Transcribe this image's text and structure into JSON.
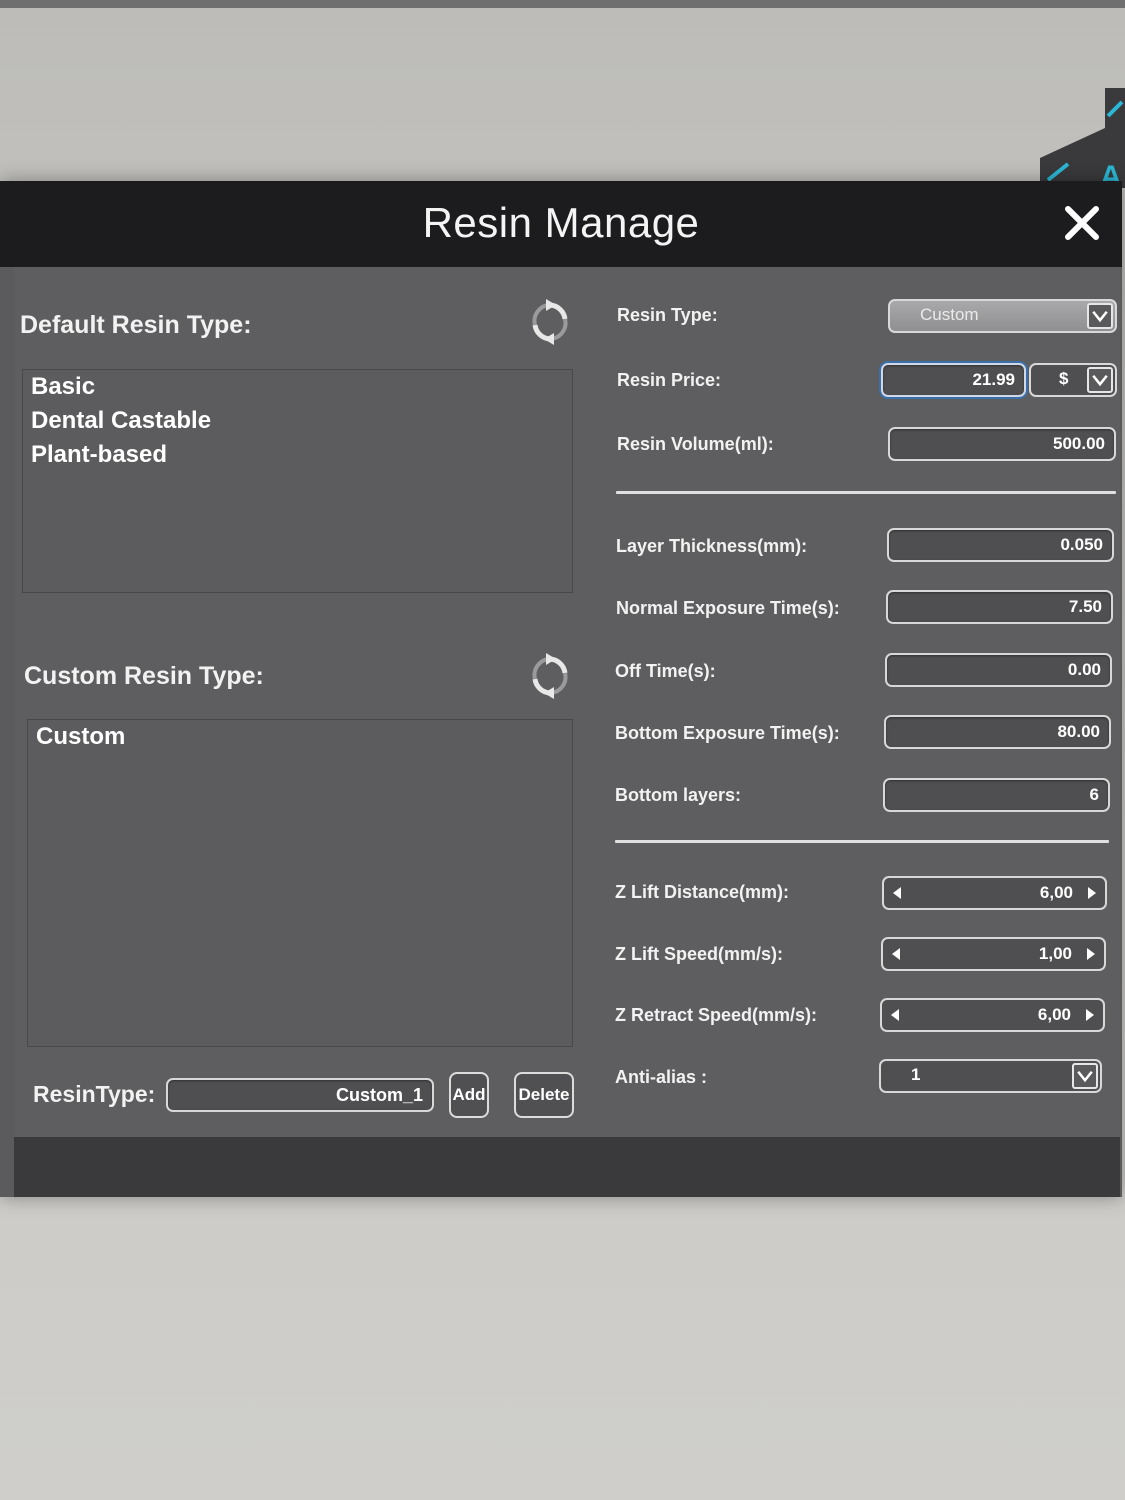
{
  "dialog": {
    "title": "Resin Manage"
  },
  "left": {
    "default_label": "Default Resin Type:",
    "default_items": [
      "Basic",
      "Dental Castable",
      "Plant-based"
    ],
    "custom_label": "Custom Resin Type:",
    "custom_items": [
      "Custom"
    ],
    "resintype_label": "ResinType:",
    "resintype_value": "Custom_1",
    "add_label": "Add",
    "delete_label": "Delete"
  },
  "right": {
    "resin_type": {
      "label": "Resin Type:",
      "value": "Custom"
    },
    "resin_price": {
      "label": "Resin Price:",
      "value": "21.99",
      "currency": "$"
    },
    "resin_volume": {
      "label": "Resin Volume(ml):",
      "value": "500.00"
    },
    "layer_thickness": {
      "label": "Layer Thickness(mm):",
      "value": "0.050"
    },
    "normal_exposure": {
      "label": "Normal Exposure Time(s):",
      "value": "7.50"
    },
    "off_time": {
      "label": "Off Time(s):",
      "value": "0.00"
    },
    "bottom_exposure": {
      "label": "Bottom Exposure Time(s):",
      "value": "80.00"
    },
    "bottom_layers": {
      "label": "Bottom layers:",
      "value": "6"
    },
    "z_lift_distance": {
      "label": "Z Lift Distance(mm):",
      "value": "6,00"
    },
    "z_lift_speed": {
      "label": "Z Lift Speed(mm/s):",
      "value": "1,00"
    },
    "z_retract_speed": {
      "label": "Z Retract Speed(mm/s):",
      "value": "6,00"
    },
    "anti_alias": {
      "label": "Anti-alias :",
      "value": "1"
    }
  },
  "colors": {
    "titlebar": "#1c1c1e",
    "panel": "#5e5e60",
    "accent_cyan": "#2bb8d6"
  }
}
